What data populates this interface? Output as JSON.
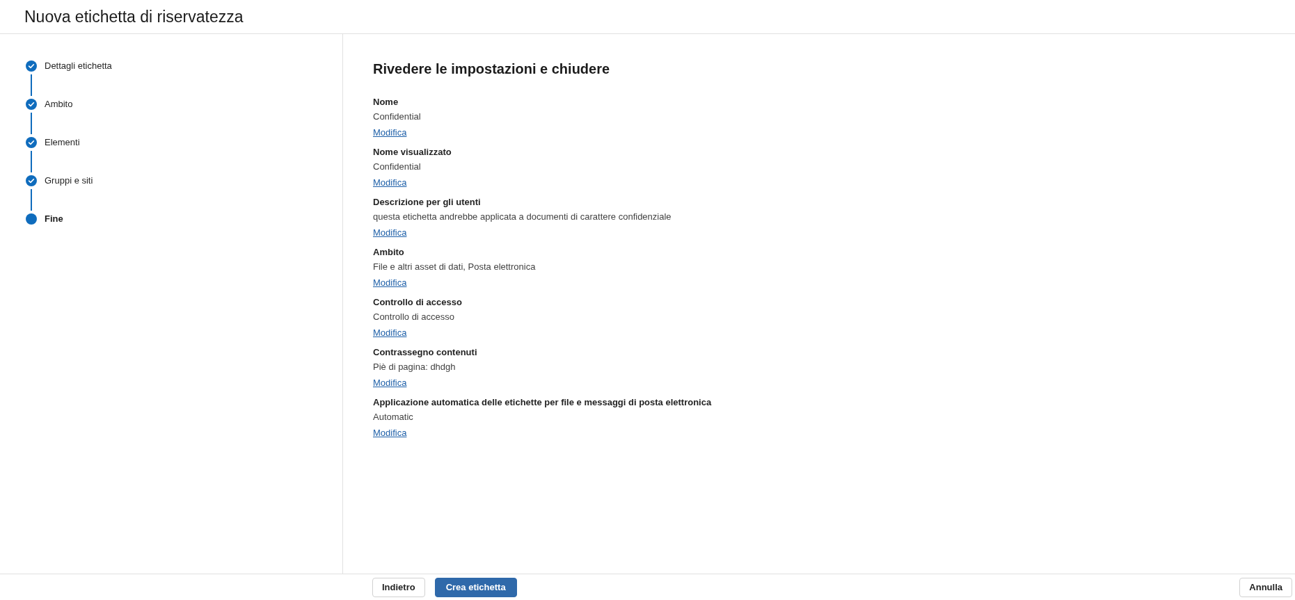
{
  "window": {
    "title": "Nuova etichetta di riservatezza"
  },
  "steps": [
    {
      "label": "Dettagli etichetta",
      "completed": true,
      "selected": false
    },
    {
      "label": "Ambito",
      "completed": true,
      "selected": false
    },
    {
      "label": "Elementi",
      "completed": true,
      "selected": false
    },
    {
      "label": "Gruppi e siti",
      "completed": true,
      "selected": false
    },
    {
      "label": "Fine",
      "completed": false,
      "selected": true
    }
  ],
  "review": {
    "heading": "Rivedere le impostazioni e chiudere",
    "sections": [
      {
        "label": "Nome",
        "value": "Confidential",
        "link": "Modifica"
      },
      {
        "label": "Nome visualizzato",
        "value": "Confidential",
        "link": "Modifica"
      },
      {
        "label": "Descrizione per gli utenti",
        "value": "questa etichetta andrebbe applicata a documenti di carattere confidenziale",
        "link": "Modifica"
      },
      {
        "label": "Ambito",
        "value": "File e altri asset di dati, Posta elettronica",
        "link": "Modifica"
      },
      {
        "label": "Controllo di accesso",
        "value": "Controllo di accesso",
        "link": "Modifica"
      },
      {
        "label": "Contrassegno contenuti",
        "value": "Piè di pagina: dhdgh",
        "link": "Modifica"
      },
      {
        "label": "Applicazione automatica delle etichette per file e messaggi di posta elettronica",
        "value": "Automatic",
        "link": "Modifica"
      }
    ]
  },
  "footer": {
    "buttons": [
      {
        "label": "Indietro",
        "kind": "secondary"
      },
      {
        "label": "Crea etichetta",
        "kind": "primary"
      },
      {
        "label": "Annulla",
        "kind": "cancel"
      }
    ]
  }
}
